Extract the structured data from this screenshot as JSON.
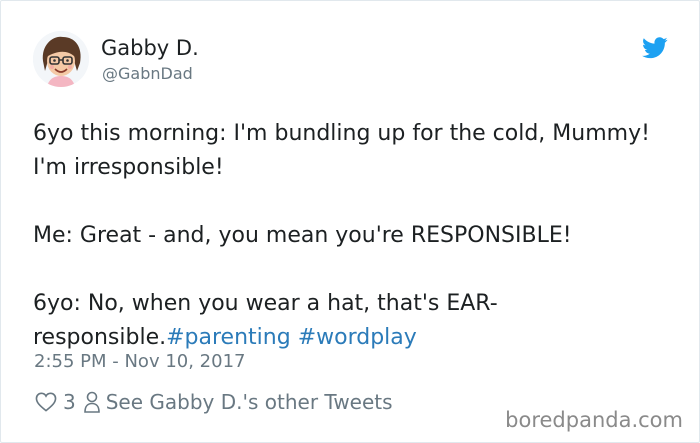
{
  "author": {
    "name": "Gabby D.",
    "handle": "@GabnDad",
    "avatar_icon": "cartoon-avatar-with-glasses"
  },
  "tweet": {
    "line1": "6yo this morning: I'm bundling up for the cold, Mummy! I'm irresponsible!",
    "line2": "Me: Great - and, you mean you're RESPONSIBLE!",
    "line3": "6yo: No, when you wear a hat, that's EAR-responsible.",
    "hashtags": [
      "#parenting",
      "#wordplay"
    ],
    "timestamp": "2:55 PM - Nov 10, 2017"
  },
  "actions": {
    "like_icon": "heart-icon",
    "like_count": "3",
    "profile_icon": "person-icon",
    "profile_link": "See Gabby D.'s other Tweets"
  },
  "watermark": "boredpanda.com",
  "colors": {
    "twitter_blue": "#1da1f2",
    "hashtag_blue": "#2b7bb9",
    "secondary_gray": "#697882",
    "text_dark": "#1c2022"
  }
}
